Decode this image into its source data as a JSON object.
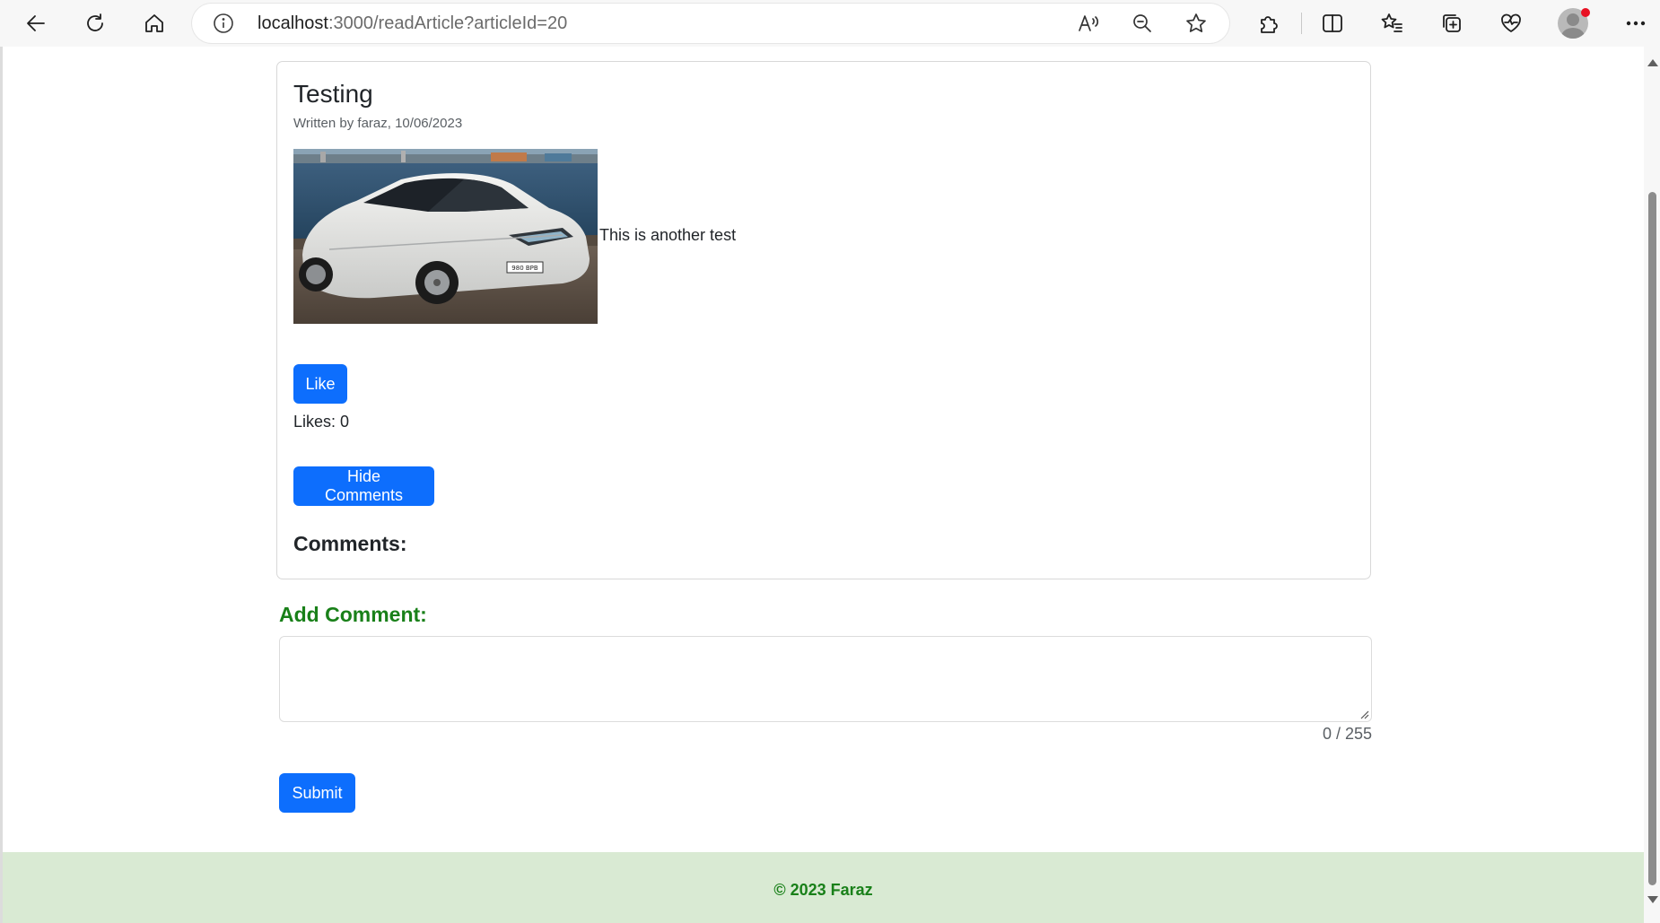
{
  "browser": {
    "url_host": "localhost",
    "url_path": ":3000/readArticle?articleId=20"
  },
  "article": {
    "title": "Testing",
    "byline": "Written by faraz, 10/06/2023",
    "body": "This is another test",
    "image_subject": "white hybrid car parked by the harbor"
  },
  "actions": {
    "like_label": "Like",
    "likes_label": "Likes:",
    "likes_count": "0",
    "hide_comments_label": "Hide Comments"
  },
  "comments": {
    "heading": "Comments:"
  },
  "add_comment": {
    "heading": "Add Comment:",
    "value": "",
    "char_count": "0 / 255",
    "submit_label": "Submit"
  },
  "footer": {
    "text": "© 2023 Faraz"
  },
  "colors": {
    "primary": "#0d6efd",
    "heading_green": "#198019",
    "footer_bg": "#d9ead3"
  }
}
